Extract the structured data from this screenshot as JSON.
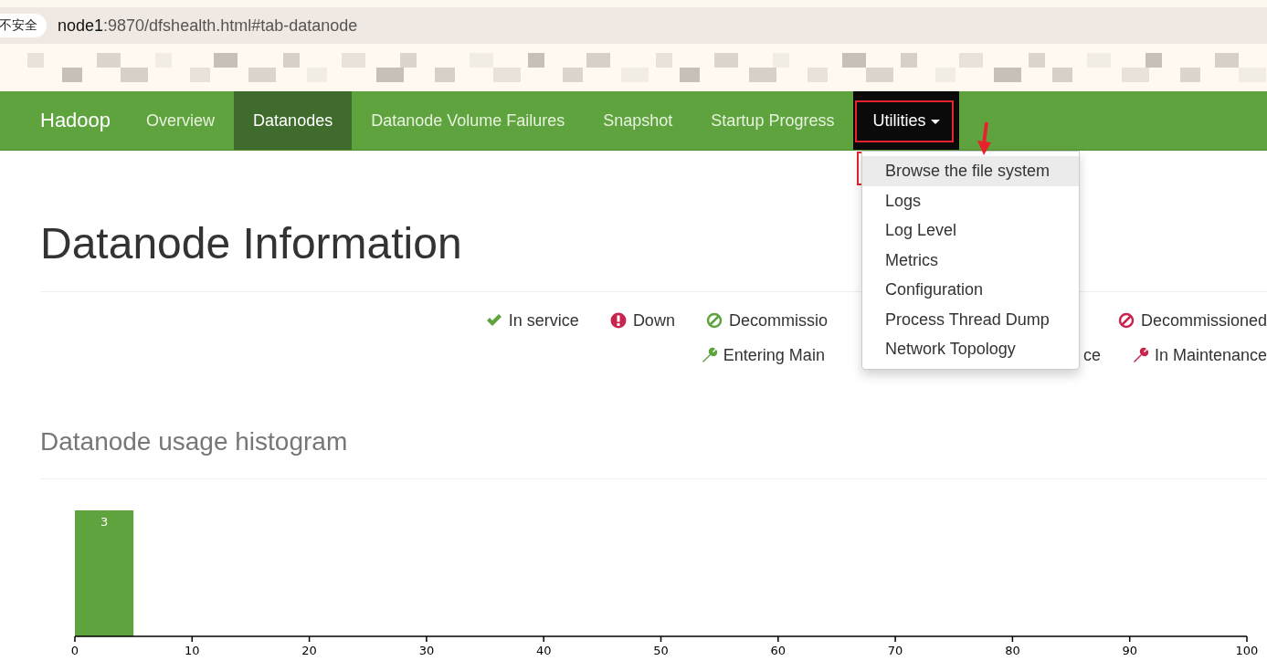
{
  "browser": {
    "security": "不安全",
    "url_host": "node1",
    "url_rest": ":9870/dfshealth.html#tab-datanode"
  },
  "navbar": {
    "brand": "Hadoop",
    "items": [
      {
        "label": "Overview",
        "selected": false,
        "kind": "link"
      },
      {
        "label": "Datanodes",
        "selected": true,
        "kind": "link"
      },
      {
        "label": "Datanode Volume Failures",
        "selected": false,
        "kind": "link"
      },
      {
        "label": "Snapshot",
        "selected": false,
        "kind": "link"
      },
      {
        "label": "Startup Progress",
        "selected": false,
        "kind": "link"
      },
      {
        "label": "Utilities",
        "selected": true,
        "kind": "dropdown"
      }
    ]
  },
  "dropdown": {
    "items": [
      {
        "label": "Browse the file system",
        "selected": true
      },
      {
        "label": "Logs",
        "selected": false
      },
      {
        "label": "Log Level",
        "selected": false
      },
      {
        "label": "Metrics",
        "selected": false
      },
      {
        "label": "Configuration",
        "selected": false
      },
      {
        "label": "Process Thread Dump",
        "selected": false
      },
      {
        "label": "Network Topology",
        "selected": false
      }
    ]
  },
  "title": "Datanode Information",
  "legend": [
    [
      {
        "kind": "check",
        "label": "In service",
        "color": "#5fa33e"
      },
      {
        "kind": "exclamation",
        "label": "Down",
        "color": "#c7254e"
      },
      {
        "kind": "slash",
        "label": "Decommissio",
        "color": "#5fa33e"
      },
      {
        "kind": "slash",
        "label": "Decommissioned",
        "color": "#c7254e"
      }
    ],
    [
      {
        "kind": "wrench",
        "label": "Entering Main",
        "color": "#5fa33e"
      },
      {
        "kind": "none",
        "label": "ce"
      },
      {
        "kind": "wrench",
        "label": "In Maintenance",
        "color": "#c7254e"
      }
    ]
  ],
  "histogram": {
    "title": "Datanode usage histogram",
    "chart_data": {
      "type": "bar",
      "x": [
        2.5
      ],
      "values": [
        3
      ],
      "xlim": [
        0,
        100
      ],
      "xticks": [
        0,
        10,
        20,
        30,
        40,
        50,
        60,
        70,
        80,
        90,
        100
      ],
      "data_labels": true
    }
  }
}
